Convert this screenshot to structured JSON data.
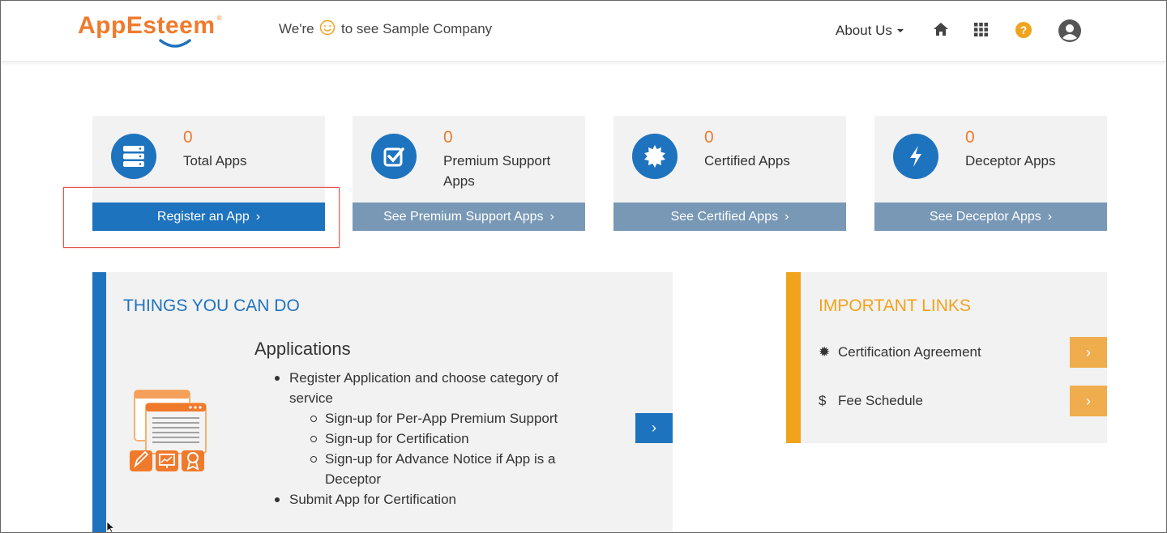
{
  "header": {
    "logo_text": "AppEsteem",
    "logo_reg": "®",
    "welcome_before": "We're",
    "welcome_after": "to see Sample Company",
    "about_label": "About Us",
    "icons": [
      "home-icon",
      "apps-grid-icon",
      "help-icon",
      "user-icon"
    ]
  },
  "cards": [
    {
      "count": "0",
      "label": "Total Apps",
      "button": "Register an App",
      "icon": "server-icon"
    },
    {
      "count": "0",
      "label": "Premium Support Apps",
      "button": "See Premium Support Apps",
      "icon": "check-icon"
    },
    {
      "count": "0",
      "label": "Certified Apps",
      "button": "See Certified Apps",
      "icon": "seal-icon"
    },
    {
      "count": "0",
      "label": "Deceptor Apps",
      "button": "See Deceptor Apps",
      "icon": "bolt-icon"
    }
  ],
  "chevron": "›",
  "things": {
    "title": "THINGS YOU CAN DO",
    "heading": "Applications",
    "items": [
      {
        "text": "Register Application and choose category of service",
        "sub": [
          "Sign-up for Per-App Premium Support",
          "Sign-up for Certification",
          "Sign-up for Advance Notice if App is a Deceptor"
        ]
      },
      {
        "text": "Submit App for Certification",
        "sub": []
      }
    ]
  },
  "links": {
    "title": "IMPORTANT LINKS",
    "items": [
      {
        "icon": "✹",
        "label": "Certification Agreement"
      },
      {
        "icon": "$",
        "label": "Fee Schedule"
      }
    ]
  },
  "colors": {
    "brand_orange": "#f07a2c",
    "primary_blue": "#1e73be",
    "muted_blue": "#7898b5",
    "links_orange": "#f0a31c",
    "highlight_red": "#e3554e"
  }
}
